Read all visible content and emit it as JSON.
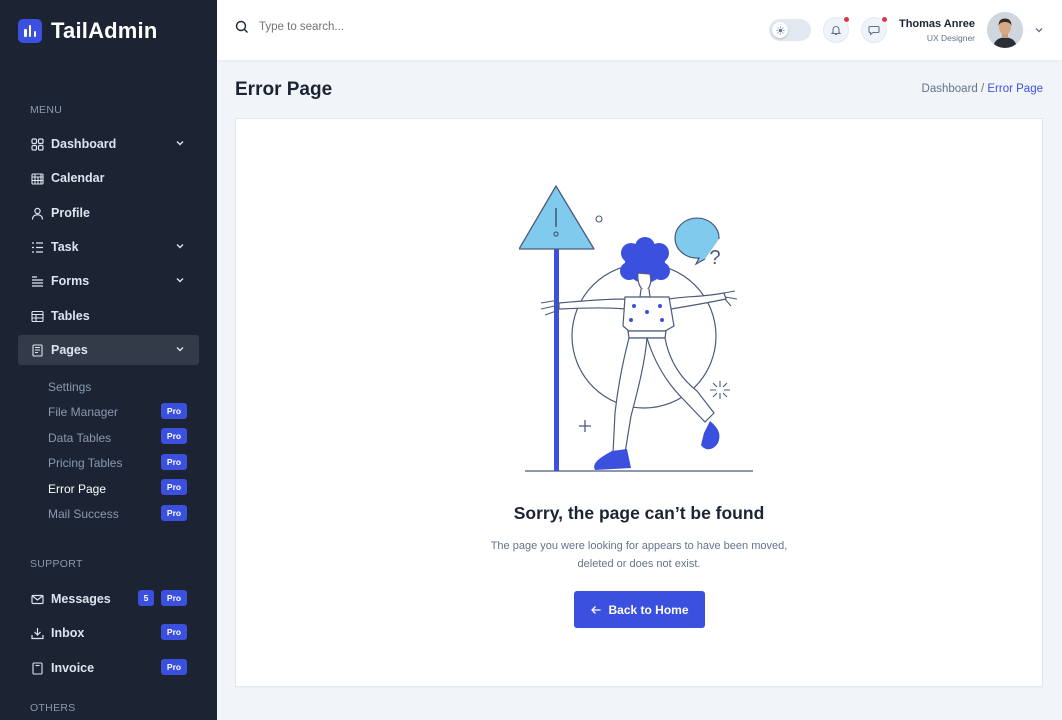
{
  "brand": {
    "name": "TailAdmin"
  },
  "sidebar": {
    "menu_label": "MENU",
    "items": [
      {
        "label": "Dashboard",
        "icon": "grid-icon",
        "has_chevron": true
      },
      {
        "label": "Calendar",
        "icon": "calendar-icon",
        "has_chevron": false
      },
      {
        "label": "Profile",
        "icon": "user-icon",
        "has_chevron": false
      },
      {
        "label": "Task",
        "icon": "list-icon",
        "has_chevron": true
      },
      {
        "label": "Forms",
        "icon": "form-icon",
        "has_chevron": true
      },
      {
        "label": "Tables",
        "icon": "table-icon",
        "has_chevron": false
      },
      {
        "label": "Pages",
        "icon": "pages-icon",
        "has_chevron": true,
        "active": true
      }
    ],
    "pages_sub": [
      {
        "label": "Settings",
        "pro": false
      },
      {
        "label": "File Manager",
        "pro": true
      },
      {
        "label": "Data Tables",
        "pro": true
      },
      {
        "label": "Pricing Tables",
        "pro": true
      },
      {
        "label": "Error Page",
        "pro": true,
        "current": true
      },
      {
        "label": "Mail Success",
        "pro": true
      }
    ],
    "support_label": "SUPPORT",
    "support_items": [
      {
        "label": "Messages",
        "count": "5",
        "pro": true,
        "icon": "mail-icon"
      },
      {
        "label": "Inbox",
        "pro": true,
        "icon": "inbox-icon"
      },
      {
        "label": "Invoice",
        "pro": true,
        "icon": "invoice-icon"
      }
    ],
    "others_label": "OTHERS",
    "pro_badge": "Pro"
  },
  "header": {
    "search_placeholder": "Type to search...",
    "user_name": "Thomas Anree",
    "user_role": "UX Designer"
  },
  "page": {
    "title": "Error Page",
    "breadcrumb_parent": "Dashboard /",
    "breadcrumb_current": "Error Page"
  },
  "error": {
    "title": "Sorry, the page can’t be found",
    "description": "The page you were looking for appears to have been moved, deleted or does not exist.",
    "button_label": "Back to Home"
  },
  "colors": {
    "sidebar_bg": "#1c2434",
    "primary": "#3c50e0",
    "page_bg": "#f1f5f9",
    "notification_dot": "#dc3545"
  }
}
